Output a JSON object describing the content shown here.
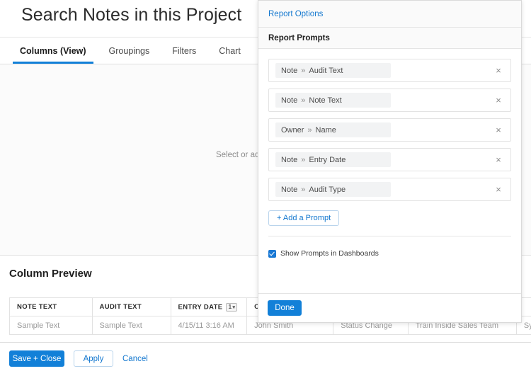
{
  "page": {
    "title": "Search Notes in this Project",
    "canvas_hint": "Select or add",
    "tabs": [
      {
        "label": "Columns (View)",
        "active": true
      },
      {
        "label": "Groupings",
        "active": false
      },
      {
        "label": "Filters",
        "active": false
      },
      {
        "label": "Chart",
        "active": false
      }
    ]
  },
  "preview": {
    "title": "Column Preview",
    "columns": [
      {
        "header": "NOTE TEXT",
        "sort": null
      },
      {
        "header": "AUDIT TEXT",
        "sort": null
      },
      {
        "header": "ENTRY DATE",
        "sort": "1"
      },
      {
        "header": "OWNER: NAME",
        "sort": null
      },
      {
        "header": "",
        "sort": null
      },
      {
        "header": "",
        "sort": null
      },
      {
        "header": "",
        "sort": null
      }
    ],
    "rows": [
      [
        "Sample Text",
        "Sample Text",
        "4/15/11 3:16 AM",
        "John Smith",
        "Status Change",
        "Train Inside Sales Team",
        "Sync duplicating contacts"
      ]
    ]
  },
  "footer": {
    "save_close": "Save + Close",
    "apply": "Apply",
    "cancel": "Cancel"
  },
  "dialog": {
    "tab_label": "Report Options",
    "section_title": "Report Prompts",
    "prompts": [
      {
        "object": "Note",
        "field": "Audit Text"
      },
      {
        "object": "Note",
        "field": "Note Text"
      },
      {
        "object": "Owner",
        "field": "Name"
      },
      {
        "object": "Note",
        "field": "Entry Date"
      },
      {
        "object": "Note",
        "field": "Audit Type"
      }
    ],
    "add_prompt_label": "+ Add a Prompt",
    "show_prompts_label": "Show Prompts in Dashboards",
    "show_prompts_checked": true,
    "done_label": "Done",
    "remove_icon": "×",
    "chevron": "»"
  },
  "colors": {
    "accent": "#1280d8",
    "link": "#1478cf",
    "chip_bg": "#f2f3f4",
    "border": "#e3e3e3"
  }
}
